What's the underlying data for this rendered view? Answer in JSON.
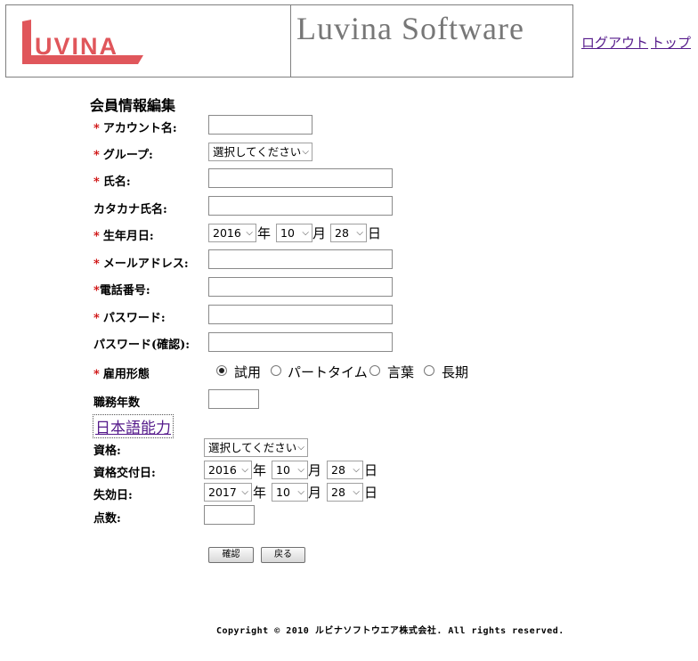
{
  "header": {
    "logo_text": "LUVINA",
    "title": "Luvina Software",
    "logout_label": "ログアウト",
    "top_label": "トップ"
  },
  "form": {
    "title": "会員情報編集",
    "required_mark": "*",
    "account_label": "アカウント名:",
    "account_value": "",
    "group_label": "グループ:",
    "group_selected": "選択してください",
    "name_label": "氏名:",
    "name_value": "",
    "kana_label": "カタカナ氏名:",
    "kana_value": "",
    "birth_label": "生年月日:",
    "birth_year": "2016",
    "birth_month": "10",
    "birth_day": "28",
    "year_unit": "年",
    "month_unit": "月",
    "day_unit": "日",
    "email_label": "メールアドレス:",
    "email_value": "",
    "phone_label": "電話番号:",
    "phone_value": "",
    "password_label": "パスワード:",
    "password_value": "",
    "password_confirm_label": "パスワード(確認):",
    "password_confirm_value": "",
    "employment_label": "雇用形態",
    "employment_options": [
      "試用",
      "パートタイム",
      "言葉",
      "長期"
    ],
    "employment_selected_index": 0,
    "years_label": "職務年数",
    "years_value": "",
    "japanese_section": "日本語能力",
    "qual_label": "資格:",
    "qual_selected": "選択してください",
    "issue_label": "資格交付日:",
    "issue_year": "2016",
    "issue_month": "10",
    "issue_day": "28",
    "expire_label": "失効日:",
    "expire_year": "2017",
    "expire_month": "10",
    "expire_day": "28",
    "score_label": "点数:",
    "score_value": "",
    "confirm_button": "確認",
    "back_button": "戻る"
  },
  "footer": {
    "copyright": "Copyright © 2010 ルビナソフトウエア株式会社. All rights reserved."
  },
  "colors": {
    "logo_red": "#e0565b",
    "title_gray": "#777777",
    "required_red": "#cc0000",
    "link_purple": "#551a8b"
  }
}
